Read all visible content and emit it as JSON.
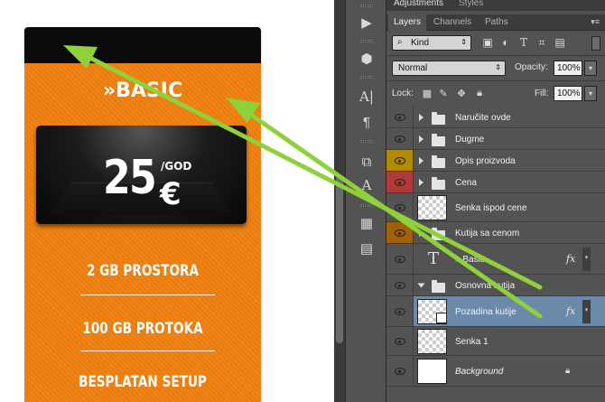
{
  "canvas": {
    "plan_title": "»BASIC",
    "price_amount": "25",
    "price_period": "/GOD",
    "price_currency": "€",
    "features": [
      "2 GB PROSTORA",
      "100 GB PROTOKA",
      "BESPLATAN SETUP"
    ]
  },
  "adjustments_tabs": [
    "Adjustments",
    "Styles"
  ],
  "layer_tabs": [
    "Layers",
    "Channels",
    "Paths"
  ],
  "filter": {
    "kind_label": "Kind"
  },
  "blend": {
    "mode": "Normal",
    "opacity_label": "Opacity:",
    "opacity_value": "100%",
    "fill_label": "Fill:",
    "fill_value": "100%",
    "lock_label": "Lock:"
  },
  "layers": [
    {
      "name": "Naručite ovde",
      "type": "group",
      "eye_color": ""
    },
    {
      "name": "Dugme",
      "type": "group",
      "eye_color": ""
    },
    {
      "name": "Opis proizvoda",
      "type": "group",
      "eye_color": "#b08a00"
    },
    {
      "name": "Cena",
      "type": "group",
      "eye_color": "#b03a3a"
    },
    {
      "name": "Senka ispod cene",
      "type": "pixel",
      "eye_color": ""
    },
    {
      "name": "Kutija sa cenom",
      "type": "group",
      "eye_color": "#a0600a"
    },
    {
      "name": "» Basic",
      "type": "text",
      "fx": "fx",
      "eye_color": ""
    },
    {
      "name": "Osnovna kutija",
      "type": "group",
      "eye_color": ""
    },
    {
      "name": "Pozadina kutije",
      "type": "pixel",
      "fx": "fx",
      "selected": true,
      "eye_color": ""
    },
    {
      "name": "Senka 1",
      "type": "pixel",
      "eye_color": ""
    },
    {
      "name": "Background",
      "type": "background",
      "eye_color": ""
    }
  ],
  "colors": {
    "arrow": "#8fd13a",
    "card": "#ef8010",
    "selected_row": "#6b8aaa",
    "panel_bg": "#535353"
  },
  "icons": {
    "tools": [
      "play-icon",
      "3d-cube-icon",
      "text-character-icon",
      "paragraph-icon",
      "layer-comps-icon",
      "text-icon",
      "swatches-icon",
      "notes-icon"
    ]
  }
}
